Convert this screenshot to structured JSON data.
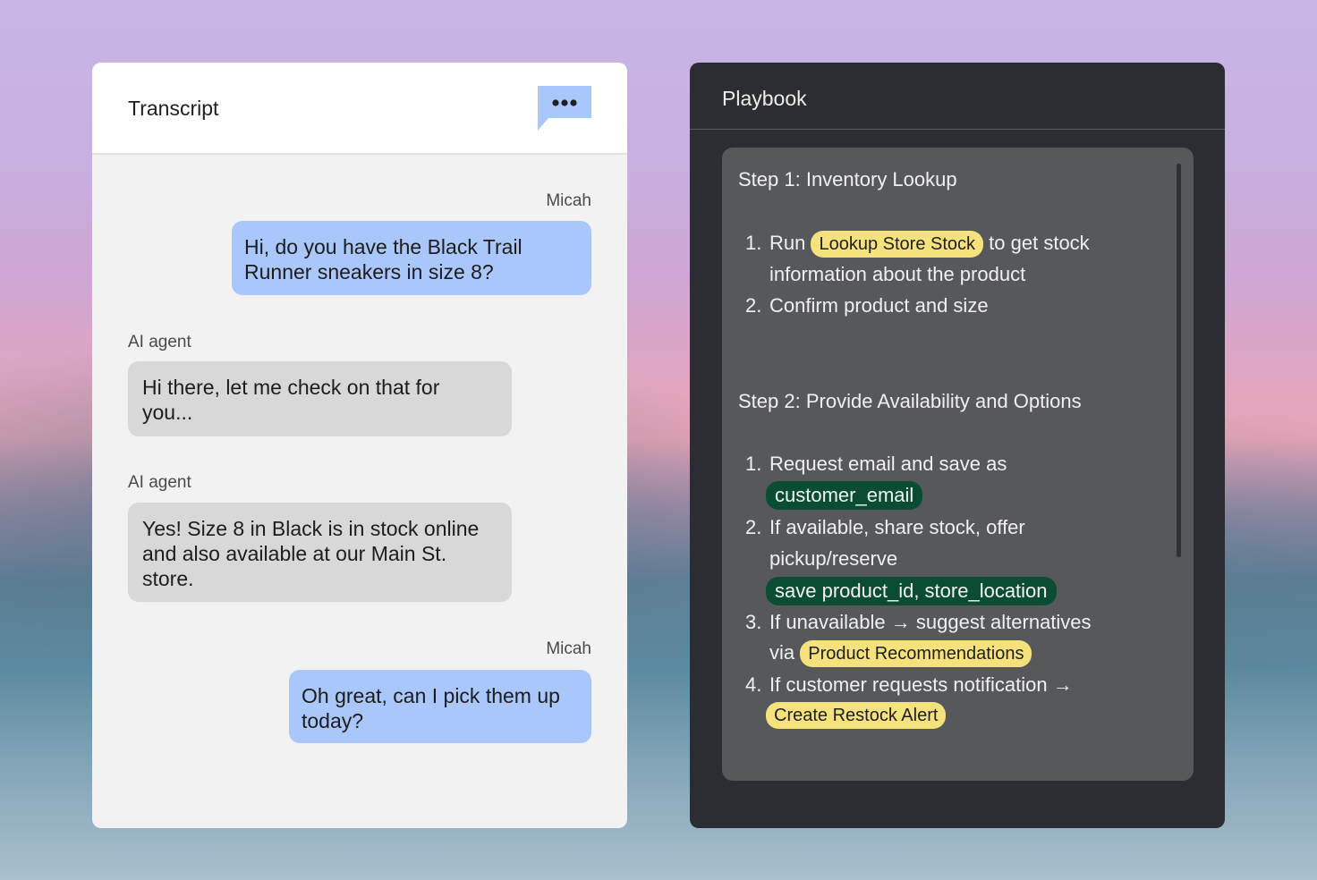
{
  "transcript": {
    "title": "Transcript",
    "more_icon": "more-dots-icon",
    "messages": [
      {
        "sender": "Micah",
        "role": "user",
        "lines": [
          "Hi, do you have the Black Trail",
          "Runner sneakers in size 8?"
        ]
      },
      {
        "sender": "AI agent",
        "role": "agent",
        "lines": [
          "Hi there, let me check on that for",
          "you..."
        ]
      },
      {
        "sender": "AI agent",
        "role": "agent",
        "lines": [
          "Yes! Size 8 in Black is in stock online",
          "and also available at our Main St.",
          "store."
        ]
      },
      {
        "sender": "Micah",
        "role": "user",
        "lines": [
          "Oh great, can I pick them up",
          "today?"
        ]
      }
    ]
  },
  "playbook": {
    "title": "Playbook",
    "step1": {
      "heading": "Step 1: Inventory Lookup",
      "item1": {
        "num": "1.",
        "pre": "Run",
        "chip": "Lookup Store Stock",
        "post": "to get stock",
        "cont": "information about the product"
      },
      "item2": {
        "num": "2.",
        "text": "Confirm product and size"
      }
    },
    "step2": {
      "heading": "Step 2: Provide Availability and Options",
      "item1": {
        "num": "1.",
        "text": "Request email and save as",
        "chip": "customer_email"
      },
      "item2": {
        "num": "2.",
        "text": "If available, share stock, offer",
        "cont": "pickup/reserve",
        "chip": "save product_id, store_location"
      },
      "item3": {
        "num": "3.",
        "text": "If unavailable → suggest alternatives",
        "pre": "via",
        "chip": "Product Recommendations"
      },
      "item4": {
        "num": "4.",
        "text": "If customer requests notification →",
        "chip": "Create Restock Alert"
      }
    }
  },
  "colors": {
    "user_bubble": "#a9c7fb",
    "agent_bubble": "#d8d8d8",
    "tool_chip": "#f6e27c",
    "variable_chip": "#0b4d33",
    "playbook_bg": "#2c2d32",
    "playbook_card": "#56585c"
  }
}
